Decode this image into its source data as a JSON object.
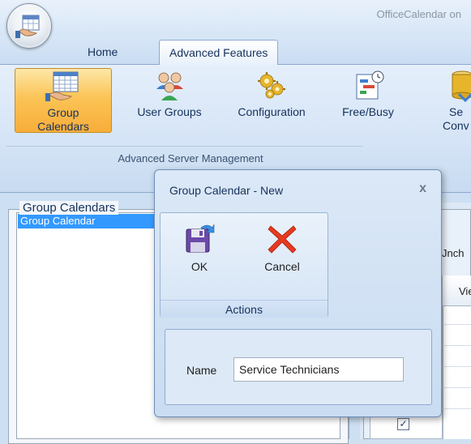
{
  "window": {
    "title": "OfficeCalendar on"
  },
  "tabs": [
    {
      "label": "Home",
      "active": false
    },
    {
      "label": "Advanced Features",
      "active": true
    }
  ],
  "ribbon": {
    "buttons": [
      {
        "label_line1": "Group",
        "label_line2": "Calendars",
        "icon": "group-calendar-icon",
        "selected": true
      },
      {
        "label_line1": "User Groups",
        "icon": "user-groups-icon",
        "selected": false
      },
      {
        "label_line1": "Configuration",
        "icon": "configuration-gears-icon",
        "selected": false
      },
      {
        "label_line1": "Free/Busy",
        "icon": "free-busy-icon",
        "selected": false
      },
      {
        "label_line1": "Se",
        "label_line2": "Conv",
        "icon": "server-conversion-icon",
        "selected": false
      }
    ],
    "group_caption": "Advanced Server Management"
  },
  "left_panel": {
    "title": "Group Calendars",
    "items": [
      "Group Calendar"
    ]
  },
  "right_panel": {
    "uncheck_text": "Jnch",
    "view_text": "View"
  },
  "dialog": {
    "title": "Group Calendar - New",
    "close_label": "x",
    "actions": {
      "ok_label": "OK",
      "cancel_label": "Cancel",
      "caption": "Actions"
    },
    "name_label": "Name",
    "name_value": "Service Technicians"
  },
  "colors": {
    "selected_ribbon": "#f8ad3a",
    "list_selection": "#3399ff",
    "cancel_red": "#e53a1f",
    "save_purple": "#6b4aa8"
  }
}
